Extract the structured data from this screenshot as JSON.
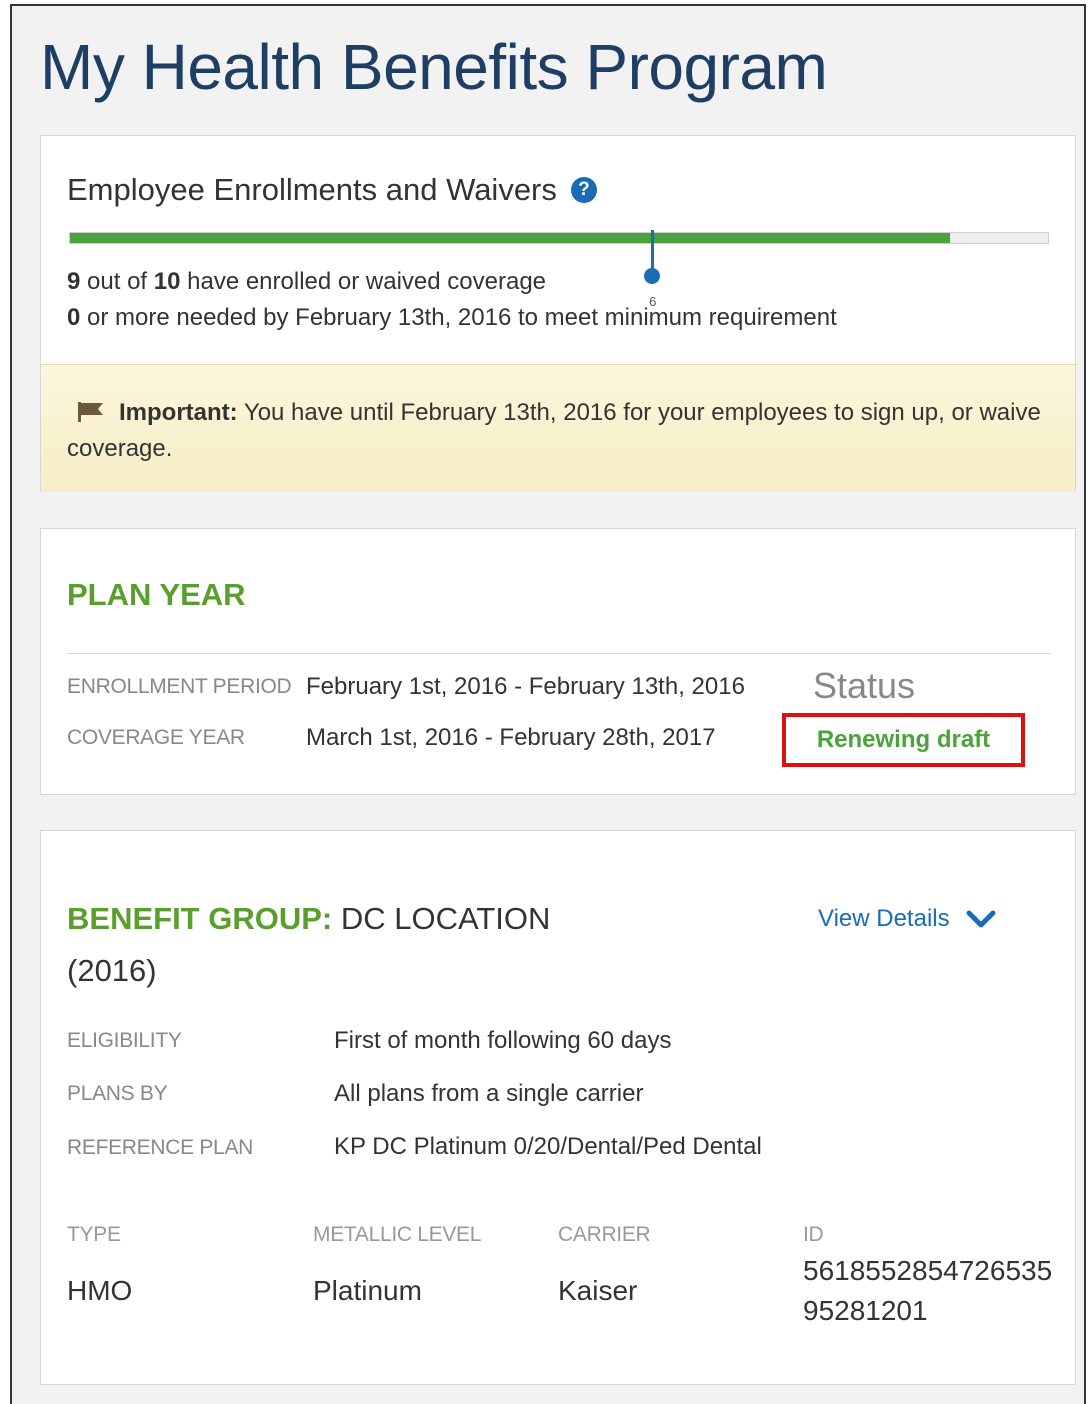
{
  "page_title": "My Health Benefits Program",
  "enrollment": {
    "title": "Employee Enrollments and Waivers",
    "progress_fraction": 0.9,
    "minimum_fraction": 0.595,
    "marker_label": "6",
    "enrolled_count": "9",
    "enrolled_text_1": "out of",
    "total_count": "10",
    "enrolled_text_2": "have enrolled or waived coverage",
    "needed_count": "0",
    "needed_text": "or more needed by February 13th, 2016 to meet minimum requirement",
    "notice_strong": "Important:",
    "notice_text": "You have until February 13th, 2016 for your employees to sign up, or waive coverage."
  },
  "plan_year": {
    "heading": "PLAN YEAR",
    "enrollment_period_label": "ENROLLMENT PERIOD",
    "enrollment_period_value": "February 1st, 2016 - February 13th, 2016",
    "coverage_year_label": "COVERAGE YEAR",
    "coverage_year_value": "March 1st, 2016 - February 28th, 2017",
    "status_label": "Status",
    "status_value": "Renewing draft",
    "highlight_color": "#e01010"
  },
  "benefit_group": {
    "heading_strong": "BENEFIT GROUP:",
    "heading_rest": "DC LOCATION (2016)",
    "view_details": "View Details",
    "eligibility_label": "ELIGIBILITY",
    "eligibility_value": "First of month following 60 days",
    "plans_by_label": "PLANS BY",
    "plans_by_value": "All plans from a single carrier",
    "reference_plan_label": "REFERENCE PLAN",
    "reference_plan_value": "KP DC Platinum 0/20/Dental/Ped Dental",
    "type_label": "TYPE",
    "type_value": "HMO",
    "metallic_label": "METALLIC LEVEL",
    "metallic_value": "Platinum",
    "carrier_label": "CARRIER",
    "carrier_value": "Kaiser",
    "id_label": "ID",
    "id_value": "561855285472653595281201"
  },
  "colors": {
    "accent_green": "#4aa33c",
    "heading_green": "#5a9e2d",
    "link_blue": "#1a6db5",
    "title_navy": "#1e3e63"
  },
  "icons": [
    "help-icon",
    "flag-icon",
    "chevron-down-icon"
  ]
}
